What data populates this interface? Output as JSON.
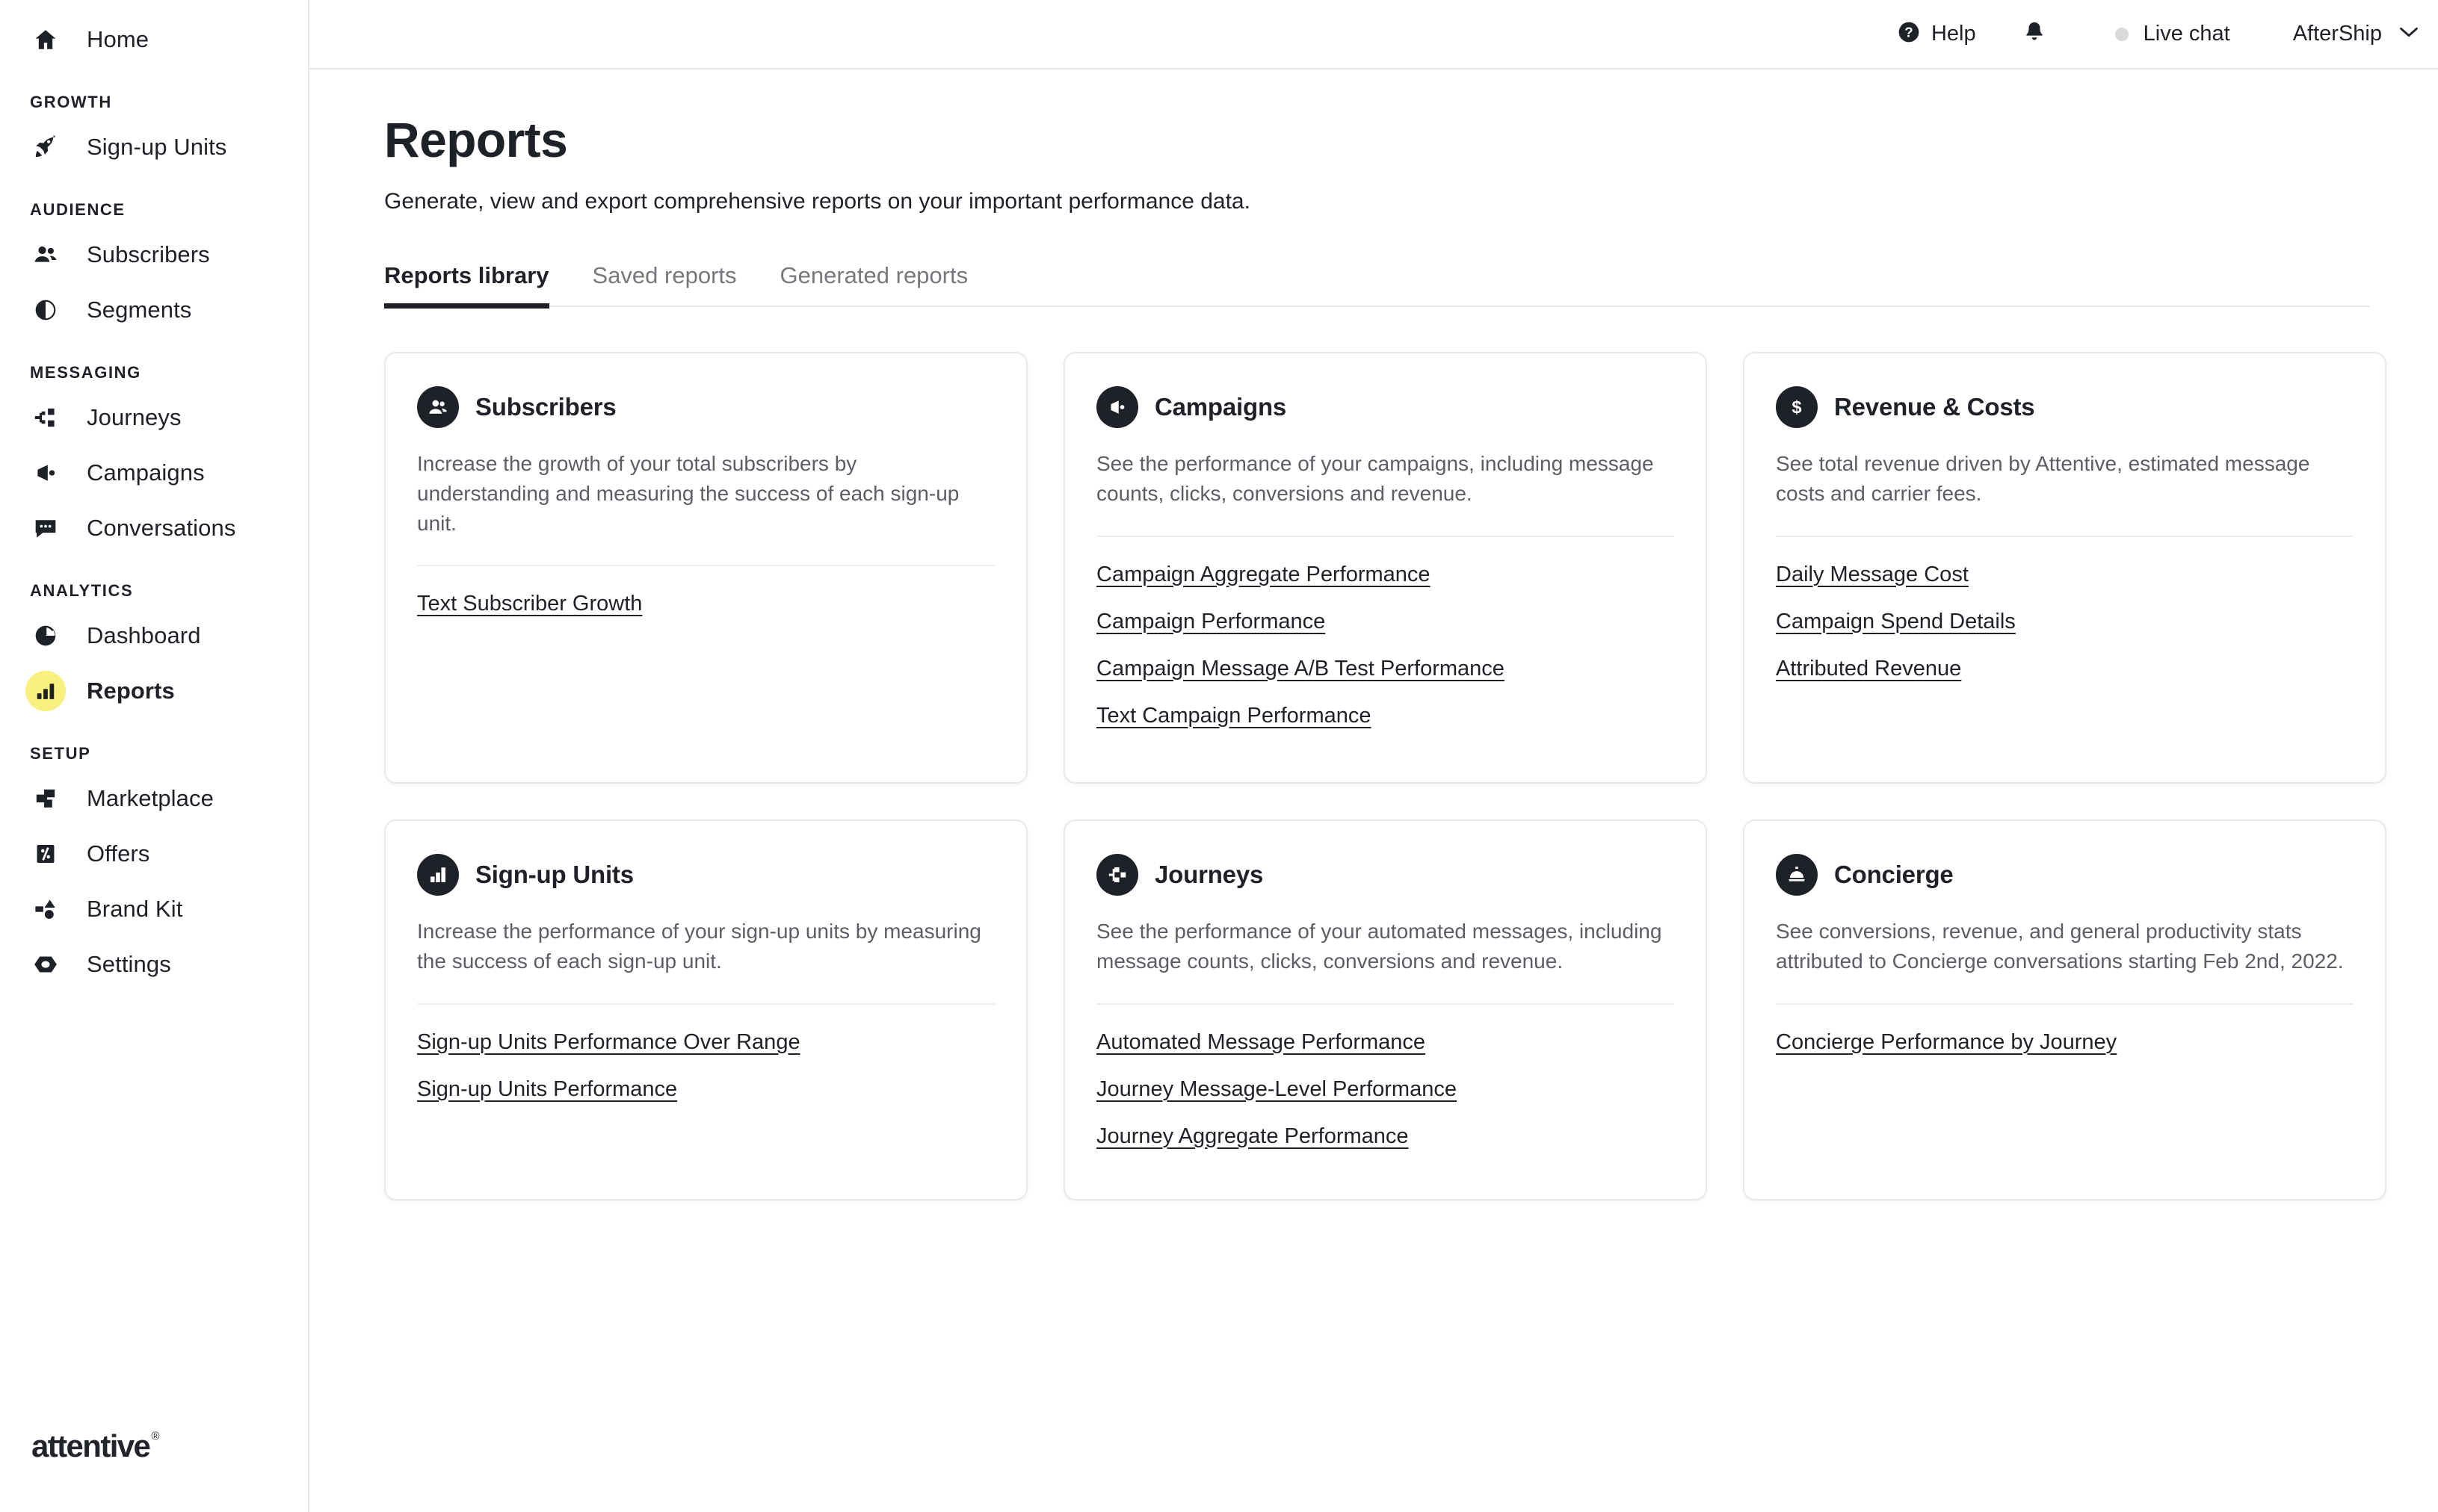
{
  "colors": {
    "accent_yellow": "#FAF080",
    "ink": "#1f2128",
    "muted": "#5c5e66",
    "border": "#e8e8ea",
    "livechat_dot": "#d9d9d9"
  },
  "sidebar": {
    "home": {
      "label": "Home",
      "icon": "home-icon"
    },
    "sections": [
      {
        "title": "GROWTH",
        "items": [
          {
            "label": "Sign-up Units",
            "icon": "rocket-icon",
            "active": false
          }
        ]
      },
      {
        "title": "AUDIENCE",
        "items": [
          {
            "label": "Subscribers",
            "icon": "people-icon",
            "active": false
          },
          {
            "label": "Segments",
            "icon": "segments-icon",
            "active": false
          }
        ]
      },
      {
        "title": "MESSAGING",
        "items": [
          {
            "label": "Journeys",
            "icon": "journeys-icon",
            "active": false
          },
          {
            "label": "Campaigns",
            "icon": "megaphone-icon",
            "active": false
          },
          {
            "label": "Conversations",
            "icon": "chat-icon",
            "active": false
          }
        ]
      },
      {
        "title": "ANALYTICS",
        "items": [
          {
            "label": "Dashboard",
            "icon": "pie-chart-icon",
            "active": false
          },
          {
            "label": "Reports",
            "icon": "bar-chart-icon",
            "active": true
          }
        ]
      },
      {
        "title": "SETUP",
        "items": [
          {
            "label": "Marketplace",
            "icon": "marketplace-icon",
            "active": false
          },
          {
            "label": "Offers",
            "icon": "percent-tag-icon",
            "active": false
          },
          {
            "label": "Brand Kit",
            "icon": "shapes-icon",
            "active": false
          },
          {
            "label": "Settings",
            "icon": "gear-icon",
            "active": false
          }
        ]
      }
    ],
    "logo": {
      "word": "attentive",
      "registered": "®"
    }
  },
  "topbar": {
    "help_label": "Help",
    "help_icon": "question-circle-icon",
    "notifications_icon": "bell-icon",
    "live_chat_label": "Live chat",
    "live_chat_status_icon": "status-dot-icon",
    "account_label": "AfterShip",
    "account_chevron_icon": "chevron-down-icon"
  },
  "page": {
    "title": "Reports",
    "subtitle": "Generate, view and export comprehensive reports on your important performance data.",
    "tabs": [
      {
        "label": "Reports library",
        "active": true
      },
      {
        "label": "Saved reports",
        "active": false
      },
      {
        "label": "Generated reports",
        "active": false
      }
    ]
  },
  "cards": [
    {
      "id": "subscribers",
      "icon": "people-badge-icon",
      "title": "Subscribers",
      "description": "Increase the growth of your total subscribers by understanding and measuring the success of each sign-up unit.",
      "links": [
        "Text Subscriber Growth"
      ]
    },
    {
      "id": "campaigns",
      "icon": "megaphone-badge-icon",
      "title": "Campaigns",
      "description": "See the performance of your campaigns, including message counts, clicks, conversions and revenue.",
      "links": [
        "Campaign Aggregate Performance",
        "Campaign Performance",
        "Campaign Message A/B Test Performance",
        "Text Campaign Performance"
      ]
    },
    {
      "id": "revenue-costs",
      "icon": "dollar-badge-icon",
      "title": "Revenue & Costs",
      "description": "See total revenue driven by Attentive, estimated message costs and carrier fees.",
      "links": [
        "Daily Message Cost",
        "Campaign Spend Details",
        "Attributed Revenue"
      ]
    },
    {
      "id": "sign-up-units",
      "icon": "bar-chart-badge-icon",
      "title": "Sign-up Units",
      "description": "Increase the performance of your sign-up units by measuring the success of each sign-up unit.",
      "links": [
        "Sign-up Units Performance Over Range",
        "Sign-up Units Performance"
      ]
    },
    {
      "id": "journeys",
      "icon": "journeys-badge-icon",
      "title": "Journeys",
      "description": "See the performance of your automated messages, including message counts, clicks, conversions and revenue.",
      "links": [
        "Automated Message Performance",
        "Journey Message-Level Performance",
        "Journey Aggregate Performance"
      ]
    },
    {
      "id": "concierge",
      "icon": "bell-badge-icon",
      "title": "Concierge",
      "description": "See conversions, revenue, and general productivity stats attributed to Concierge conversations starting Feb 2nd, 2022.",
      "links": [
        "Concierge Performance by Journey"
      ]
    }
  ]
}
